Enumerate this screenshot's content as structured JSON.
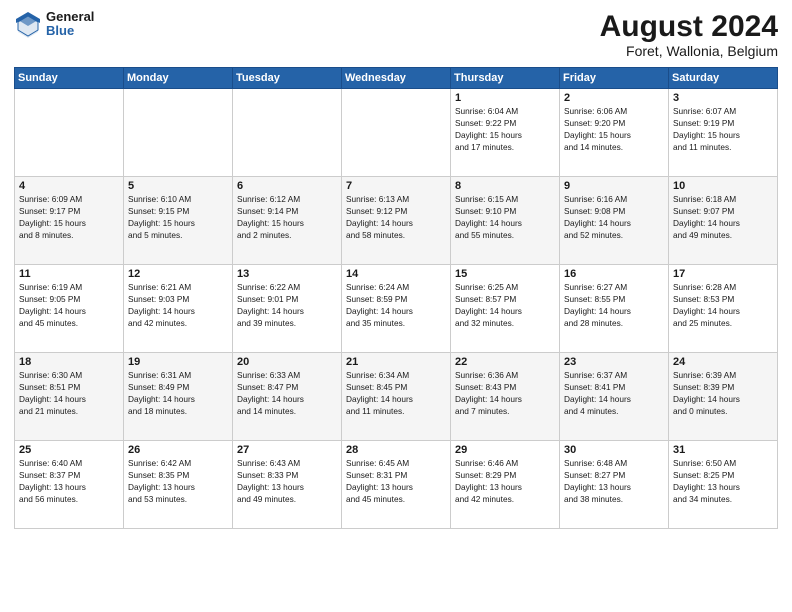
{
  "header": {
    "logo_line1": "General",
    "logo_line2": "Blue",
    "title": "August 2024",
    "subtitle": "Foret, Wallonia, Belgium"
  },
  "calendar": {
    "weekdays": [
      "Sunday",
      "Monday",
      "Tuesday",
      "Wednesday",
      "Thursday",
      "Friday",
      "Saturday"
    ],
    "weeks": [
      [
        {
          "day": "",
          "info": ""
        },
        {
          "day": "",
          "info": ""
        },
        {
          "day": "",
          "info": ""
        },
        {
          "day": "",
          "info": ""
        },
        {
          "day": "1",
          "info": "Sunrise: 6:04 AM\nSunset: 9:22 PM\nDaylight: 15 hours\nand 17 minutes."
        },
        {
          "day": "2",
          "info": "Sunrise: 6:06 AM\nSunset: 9:20 PM\nDaylight: 15 hours\nand 14 minutes."
        },
        {
          "day": "3",
          "info": "Sunrise: 6:07 AM\nSunset: 9:19 PM\nDaylight: 15 hours\nand 11 minutes."
        }
      ],
      [
        {
          "day": "4",
          "info": "Sunrise: 6:09 AM\nSunset: 9:17 PM\nDaylight: 15 hours\nand 8 minutes."
        },
        {
          "day": "5",
          "info": "Sunrise: 6:10 AM\nSunset: 9:15 PM\nDaylight: 15 hours\nand 5 minutes."
        },
        {
          "day": "6",
          "info": "Sunrise: 6:12 AM\nSunset: 9:14 PM\nDaylight: 15 hours\nand 2 minutes."
        },
        {
          "day": "7",
          "info": "Sunrise: 6:13 AM\nSunset: 9:12 PM\nDaylight: 14 hours\nand 58 minutes."
        },
        {
          "day": "8",
          "info": "Sunrise: 6:15 AM\nSunset: 9:10 PM\nDaylight: 14 hours\nand 55 minutes."
        },
        {
          "day": "9",
          "info": "Sunrise: 6:16 AM\nSunset: 9:08 PM\nDaylight: 14 hours\nand 52 minutes."
        },
        {
          "day": "10",
          "info": "Sunrise: 6:18 AM\nSunset: 9:07 PM\nDaylight: 14 hours\nand 49 minutes."
        }
      ],
      [
        {
          "day": "11",
          "info": "Sunrise: 6:19 AM\nSunset: 9:05 PM\nDaylight: 14 hours\nand 45 minutes."
        },
        {
          "day": "12",
          "info": "Sunrise: 6:21 AM\nSunset: 9:03 PM\nDaylight: 14 hours\nand 42 minutes."
        },
        {
          "day": "13",
          "info": "Sunrise: 6:22 AM\nSunset: 9:01 PM\nDaylight: 14 hours\nand 39 minutes."
        },
        {
          "day": "14",
          "info": "Sunrise: 6:24 AM\nSunset: 8:59 PM\nDaylight: 14 hours\nand 35 minutes."
        },
        {
          "day": "15",
          "info": "Sunrise: 6:25 AM\nSunset: 8:57 PM\nDaylight: 14 hours\nand 32 minutes."
        },
        {
          "day": "16",
          "info": "Sunrise: 6:27 AM\nSunset: 8:55 PM\nDaylight: 14 hours\nand 28 minutes."
        },
        {
          "day": "17",
          "info": "Sunrise: 6:28 AM\nSunset: 8:53 PM\nDaylight: 14 hours\nand 25 minutes."
        }
      ],
      [
        {
          "day": "18",
          "info": "Sunrise: 6:30 AM\nSunset: 8:51 PM\nDaylight: 14 hours\nand 21 minutes."
        },
        {
          "day": "19",
          "info": "Sunrise: 6:31 AM\nSunset: 8:49 PM\nDaylight: 14 hours\nand 18 minutes."
        },
        {
          "day": "20",
          "info": "Sunrise: 6:33 AM\nSunset: 8:47 PM\nDaylight: 14 hours\nand 14 minutes."
        },
        {
          "day": "21",
          "info": "Sunrise: 6:34 AM\nSunset: 8:45 PM\nDaylight: 14 hours\nand 11 minutes."
        },
        {
          "day": "22",
          "info": "Sunrise: 6:36 AM\nSunset: 8:43 PM\nDaylight: 14 hours\nand 7 minutes."
        },
        {
          "day": "23",
          "info": "Sunrise: 6:37 AM\nSunset: 8:41 PM\nDaylight: 14 hours\nand 4 minutes."
        },
        {
          "day": "24",
          "info": "Sunrise: 6:39 AM\nSunset: 8:39 PM\nDaylight: 14 hours\nand 0 minutes."
        }
      ],
      [
        {
          "day": "25",
          "info": "Sunrise: 6:40 AM\nSunset: 8:37 PM\nDaylight: 13 hours\nand 56 minutes."
        },
        {
          "day": "26",
          "info": "Sunrise: 6:42 AM\nSunset: 8:35 PM\nDaylight: 13 hours\nand 53 minutes."
        },
        {
          "day": "27",
          "info": "Sunrise: 6:43 AM\nSunset: 8:33 PM\nDaylight: 13 hours\nand 49 minutes."
        },
        {
          "day": "28",
          "info": "Sunrise: 6:45 AM\nSunset: 8:31 PM\nDaylight: 13 hours\nand 45 minutes."
        },
        {
          "day": "29",
          "info": "Sunrise: 6:46 AM\nSunset: 8:29 PM\nDaylight: 13 hours\nand 42 minutes."
        },
        {
          "day": "30",
          "info": "Sunrise: 6:48 AM\nSunset: 8:27 PM\nDaylight: 13 hours\nand 38 minutes."
        },
        {
          "day": "31",
          "info": "Sunrise: 6:50 AM\nSunset: 8:25 PM\nDaylight: 13 hours\nand 34 minutes."
        }
      ]
    ]
  }
}
